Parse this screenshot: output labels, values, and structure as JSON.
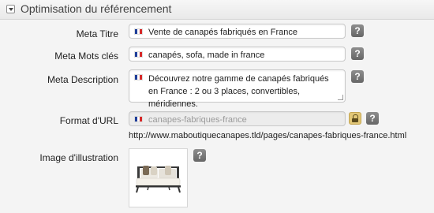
{
  "panel": {
    "title": "Optimisation du référencement",
    "toggle_icon": "collapse-arrow-icon"
  },
  "fields": {
    "meta_title": {
      "label": "Meta Titre",
      "value": "Vente de canapés fabriqués en France"
    },
    "meta_keywords": {
      "label": "Meta Mots clés",
      "value": "canapés, sofa, made in france"
    },
    "meta_description": {
      "label": "Meta Description",
      "value": "Découvrez notre gamme de canapés fabriqués en France : 2 ou 3 places, convertibles, méridiennes."
    },
    "url_format": {
      "label": "Format d'URL",
      "value": "canapes-fabriques-france",
      "locked": true
    }
  },
  "url_preview": "http://www.maboutiquecanapes.tld/pages/canapes-fabriques-france.html",
  "illustration": {
    "label": "Image d'illustration",
    "image": "sofa-photo"
  },
  "help_label": "?",
  "flag_colors": [
    "#1f3f9a",
    "#ffffff",
    "#d62828"
  ]
}
